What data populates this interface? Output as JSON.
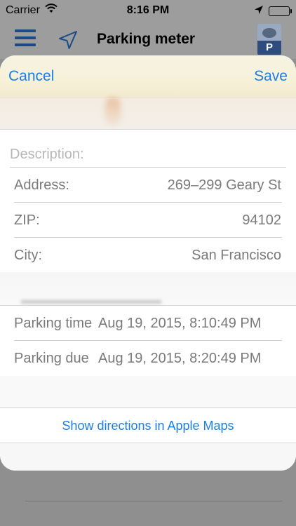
{
  "status_bar": {
    "carrier": "Carrier",
    "time": "8:16 PM"
  },
  "nav": {
    "title": "Parking meter",
    "parking_icon_letter": "P",
    "icons": [
      "menu-icon",
      "navigation-arrow-icon",
      "parking-meter-icon"
    ]
  },
  "modal": {
    "cancel_label": "Cancel",
    "save_label": "Save",
    "description_placeholder": "Description:",
    "address": {
      "label": "Address:",
      "value": "269–299 Geary St"
    },
    "zip": {
      "label": "ZIP:",
      "value": "94102"
    },
    "city": {
      "label": "City:",
      "value": "San Francisco"
    },
    "parking_time": {
      "label": "Parking time",
      "value": "Aug 19, 2015, 8:10:49 PM"
    },
    "parking_due": {
      "label": "Parking due",
      "value": "Aug 19, 2015, 8:20:49 PM"
    },
    "directions_link": "Show directions in Apple Maps"
  },
  "colors": {
    "accent": "#1a7ee8",
    "nav_icon": "#1a4b84",
    "dim_background": "#9d9d9d"
  }
}
